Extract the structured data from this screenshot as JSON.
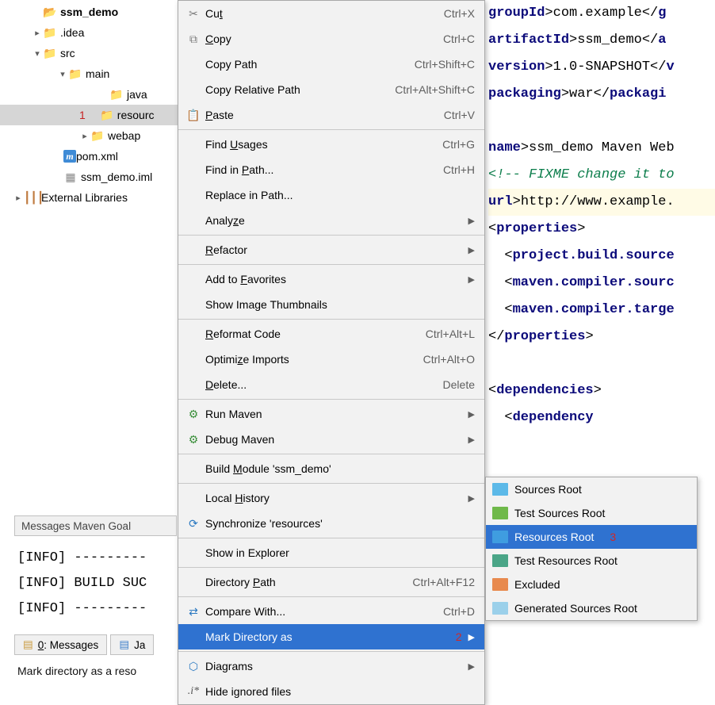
{
  "tree": {
    "items": [
      {
        "indent": 40,
        "arrow": "",
        "icon": "📂",
        "iconClass": "folder",
        "label": "ssm_demo",
        "suffix": "",
        "bold": true,
        "cut": true
      },
      {
        "indent": 40,
        "arrow": "▸",
        "icon": "📁",
        "iconClass": "folder",
        "label": ".idea"
      },
      {
        "indent": 40,
        "arrow": "▾",
        "icon": "📁",
        "iconClass": "folder",
        "label": "src"
      },
      {
        "indent": 72,
        "arrow": "▾",
        "icon": "📁",
        "iconClass": "folder",
        "label": "main"
      },
      {
        "indent": 124,
        "arrow": "",
        "icon": "📁",
        "iconClass": "folder-blue",
        "label": "java"
      },
      {
        "indent": 100,
        "arrow": "",
        "icon": "📁",
        "iconClass": "folder",
        "label": "resourc",
        "selected": true,
        "marker": "1"
      },
      {
        "indent": 100,
        "arrow": "▸",
        "icon": "📁",
        "iconClass": "folder-blue",
        "label": "webap"
      },
      {
        "indent": 66,
        "arrow": "",
        "icon": "m",
        "iconClass": "m-icon",
        "label": "pom.xml"
      },
      {
        "indent": 66,
        "arrow": "",
        "icon": "▦",
        "iconClass": "iml-icon",
        "label": "ssm_demo.iml"
      },
      {
        "indent": 16,
        "arrow": "▸",
        "icon": "┃┃┃",
        "iconClass": "lib-icon",
        "label": "External Libraries"
      }
    ]
  },
  "editor": {
    "lines": [
      {
        "t": "tag",
        "pre": "groupId",
        "txt": "com.example",
        "post": "g"
      },
      {
        "t": "tag",
        "pre": "artifactId",
        "txt": "ssm_demo",
        "post": "a"
      },
      {
        "t": "tag",
        "pre": "version",
        "txt": "1.0-SNAPSHOT",
        "post": "v"
      },
      {
        "t": "tag",
        "pre": "packaging",
        "txt": "war",
        "post": "packagi"
      },
      {
        "t": "blank"
      },
      {
        "t": "tag",
        "pre": "name",
        "txt": "ssm_demo Maven Web"
      },
      {
        "t": "comment",
        "txt": "!-- FIXME change it to"
      },
      {
        "t": "tag",
        "pre": "url",
        "txt": "http://www.example.",
        "hl": true
      },
      {
        "t": "blank",
        "hl": true
      },
      {
        "t": "open",
        "pre": "properties"
      },
      {
        "t": "open",
        "pre": "project.build.source",
        "inner": true
      },
      {
        "t": "open",
        "pre": "maven.compiler.sourc",
        "inner": true
      },
      {
        "t": "open",
        "pre": "maven.compiler.targe",
        "inner": true
      },
      {
        "t": "close",
        "pre": "properties"
      },
      {
        "t": "blank"
      },
      {
        "t": "open",
        "pre": "dependencies"
      },
      {
        "t": "open",
        "pre": "dependency",
        "inner": true
      }
    ]
  },
  "menu": {
    "items": [
      {
        "icon": "✂",
        "iconClass": "scissors",
        "label": "Cut",
        "u": "t",
        "shortcut": "Ctrl+X"
      },
      {
        "icon": "⧉",
        "iconClass": "copy-ic",
        "label": "Copy",
        "u": "C",
        "shortcut": "Ctrl+C"
      },
      {
        "label": "Copy Path",
        "shortcut": "Ctrl+Shift+C"
      },
      {
        "label": "Copy Relative Path",
        "shortcut": "Ctrl+Alt+Shift+C"
      },
      {
        "icon": "📋",
        "iconClass": "paste-ic",
        "label": "Paste",
        "u": "P",
        "shortcut": "Ctrl+V"
      },
      {
        "sep": true
      },
      {
        "label": "Find Usages",
        "u": "U",
        "shortcut": "Ctrl+G"
      },
      {
        "label": "Find in Path...",
        "u": "P",
        "shortcut": "Ctrl+H"
      },
      {
        "label": "Replace in Path..."
      },
      {
        "label": "Analyze",
        "u": "z",
        "sub": true
      },
      {
        "sep": true
      },
      {
        "label": "Refactor",
        "u": "R",
        "sub": true
      },
      {
        "sep": true
      },
      {
        "label": "Add to Favorites",
        "u": "F",
        "sub": true
      },
      {
        "label": "Show Image Thumbnails"
      },
      {
        "sep": true
      },
      {
        "label": "Reformat Code",
        "u": "R",
        "shortcut": "Ctrl+Alt+L"
      },
      {
        "label": "Optimize Imports",
        "u": "z",
        "shortcut": "Ctrl+Alt+O"
      },
      {
        "label": "Delete...",
        "u": "D",
        "shortcut": "Delete"
      },
      {
        "sep": true
      },
      {
        "icon": "⚙",
        "iconClass": "gear",
        "label": "Run Maven",
        "sub": true
      },
      {
        "icon": "⚙",
        "iconClass": "gear",
        "label": "Debug Maven",
        "sub": true
      },
      {
        "sep": true
      },
      {
        "label": "Build Module 'ssm_demo'",
        "u": "M"
      },
      {
        "sep": true
      },
      {
        "label": "Local History",
        "u": "H",
        "sub": true
      },
      {
        "icon": "⟳",
        "iconClass": "sync-ic",
        "label": "Synchronize 'resources'"
      },
      {
        "sep": true
      },
      {
        "label": "Show in Explorer"
      },
      {
        "sep": true
      },
      {
        "label": "Directory Path",
        "u": "P",
        "shortcut": "Ctrl+Alt+F12"
      },
      {
        "sep": true
      },
      {
        "icon": "⇄",
        "iconClass": "diff-ic",
        "label": "Compare With...",
        "shortcut": "Ctrl+D"
      },
      {
        "label": "Mark Directory as",
        "sub": true,
        "highlight": true,
        "marker": "2"
      },
      {
        "sep": true
      },
      {
        "icon": "⬡",
        "iconClass": "diag-ic",
        "label": "Diagrams",
        "sub": true
      },
      {
        "icon": ".i*",
        "iconClass": "ign-ic",
        "label": "Hide ignored files"
      }
    ]
  },
  "submenu": {
    "items": [
      {
        "color": "#5cb9e8",
        "label": "Sources Root"
      },
      {
        "color": "#6fb94a",
        "label": "Test Sources Root"
      },
      {
        "color": "#3f9de0",
        "label": "Resources Root",
        "highlight": true,
        "marker": "3"
      },
      {
        "color": "#4aa587",
        "label": "Test Resources Root"
      },
      {
        "color": "#e88a4e",
        "label": "Excluded"
      },
      {
        "color": "#9bd0ea",
        "label": "Generated Sources Root"
      }
    ]
  },
  "messages": {
    "header": "Messages Maven Goal",
    "lines": [
      "[INFO] ---------",
      "[INFO] BUILD SUC",
      "[INFO] ---------"
    ]
  },
  "toolTabs": {
    "messages": {
      "icon": "▤",
      "label": "0: Messages",
      "u": "0"
    },
    "java": {
      "icon": "▤",
      "label": "Ja"
    }
  },
  "status": "Mark directory as a reso"
}
